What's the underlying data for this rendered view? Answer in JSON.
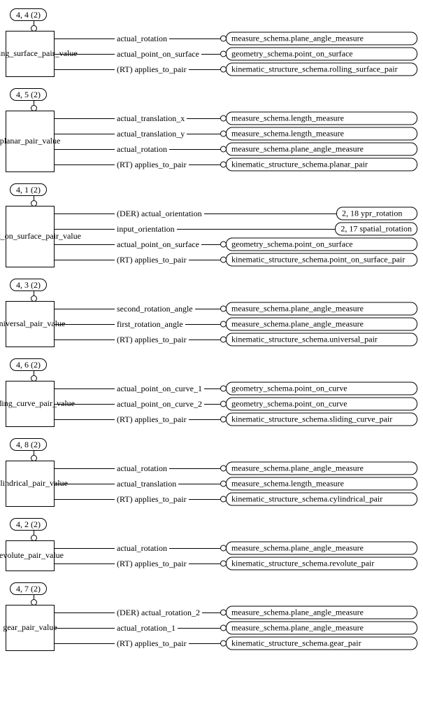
{
  "blocks": [
    {
      "ref": "4, 4 (2)",
      "entity": "*rolling_\nsurface_\npair_\nvalue",
      "attrs": [
        {
          "label": "actual_rotation",
          "target": "measure_schema.plane_angle_measure",
          "port": true,
          "wide": true
        },
        {
          "label": "actual_point_on_surface",
          "target": "geometry_schema.point_on_surface",
          "port": true,
          "wide": true
        },
        {
          "label": "(RT) applies_to_pair",
          "target": "kinematic_structure_schema.rolling_surface_pair",
          "port": true,
          "wide": true
        }
      ]
    },
    {
      "ref": "4, 5 (2)",
      "entity": "planar_\npair_\nvalue",
      "attrs": [
        {
          "label": "actual_translation_x",
          "target": "measure_schema.length_measure",
          "port": true,
          "wide": true
        },
        {
          "label": "actual_translation_y",
          "target": "measure_schema.length_measure",
          "port": true,
          "wide": true
        },
        {
          "label": "actual_rotation",
          "target": "measure_schema.plane_angle_measure",
          "port": true,
          "wide": true
        },
        {
          "label": "(RT) applies_to_pair",
          "target": "kinematic_structure_schema.planar_pair",
          "port": true,
          "wide": true
        }
      ]
    },
    {
      "ref": "4, 1 (2)",
      "entity": "*point_\non_\nsurface_\npair_\nvalue",
      "attrs": [
        {
          "label": "(DER) actual_orientation",
          "target": "2, 18 ypr_rotation",
          "port": false,
          "wide": false
        },
        {
          "label": "input_orientation",
          "target": "2, 17 spatial_rotation",
          "port": false,
          "wide": false
        },
        {
          "label": "actual_point_on_surface",
          "target": "geometry_schema.point_on_surface",
          "port": true,
          "wide": true
        },
        {
          "label": "(RT) applies_to_pair",
          "target": "kinematic_structure_schema.point_on_surface_pair",
          "port": true,
          "wide": true
        }
      ]
    },
    {
      "ref": "4, 3 (2)",
      "entity": "universal_\npair_\nvalue",
      "attrs": [
        {
          "label": "second_rotation_angle",
          "target": "measure_schema.plane_angle_measure",
          "port": true,
          "wide": true
        },
        {
          "label": "first_rotation_angle",
          "target": "measure_schema.plane_angle_measure",
          "port": true,
          "wide": true
        },
        {
          "label": "(RT) applies_to_pair",
          "target": "kinematic_structure_schema.universal_pair",
          "port": true,
          "wide": true
        }
      ]
    },
    {
      "ref": "4, 6 (2)",
      "entity": "*sliding_\ncurve_\npair_\nvalue",
      "attrs": [
        {
          "label": "actual_point_on_curve_1",
          "target": "geometry_schema.point_on_curve",
          "port": true,
          "wide": true
        },
        {
          "label": "actual_point_on_curve_2",
          "target": "geometry_schema.point_on_curve",
          "port": true,
          "wide": true
        },
        {
          "label": "(RT) applies_to_pair",
          "target": "kinematic_structure_schema.sliding_curve_pair",
          "port": true,
          "wide": true
        }
      ]
    },
    {
      "ref": "4, 8 (2)",
      "entity": "cylindrical_\npair_value",
      "attrs": [
        {
          "label": "actual_rotation",
          "target": "measure_schema.plane_angle_measure",
          "port": true,
          "wide": true
        },
        {
          "label": "actual_translation",
          "target": "measure_schema.length_measure",
          "port": true,
          "wide": true
        },
        {
          "label": "(RT) applies_to_pair",
          "target": "kinematic_structure_schema.cylindrical_pair",
          "port": true,
          "wide": true
        }
      ]
    },
    {
      "ref": "4, 2 (2)",
      "entity": "revolute_\npair_\nvalue",
      "attrs": [
        {
          "label": "actual_rotation",
          "target": "measure_schema.plane_angle_measure",
          "port": true,
          "wide": true
        },
        {
          "label": "(RT) applies_to_pair",
          "target": "kinematic_structure_schema.revolute_pair",
          "port": true,
          "wide": true
        }
      ]
    },
    {
      "ref": "4, 7 (2)",
      "entity": "gear_\npair_\nvalue",
      "attrs": [
        {
          "label": "(DER) actual_rotation_2",
          "target": "measure_schema.plane_angle_measure",
          "port": true,
          "wide": true
        },
        {
          "label": "actual_rotation_1",
          "target": "measure_schema.plane_angle_measure",
          "port": true,
          "wide": true
        },
        {
          "label": "(RT) applies_to_pair",
          "target": "kinematic_structure_schema.gear_pair",
          "port": true,
          "wide": true
        }
      ]
    }
  ]
}
